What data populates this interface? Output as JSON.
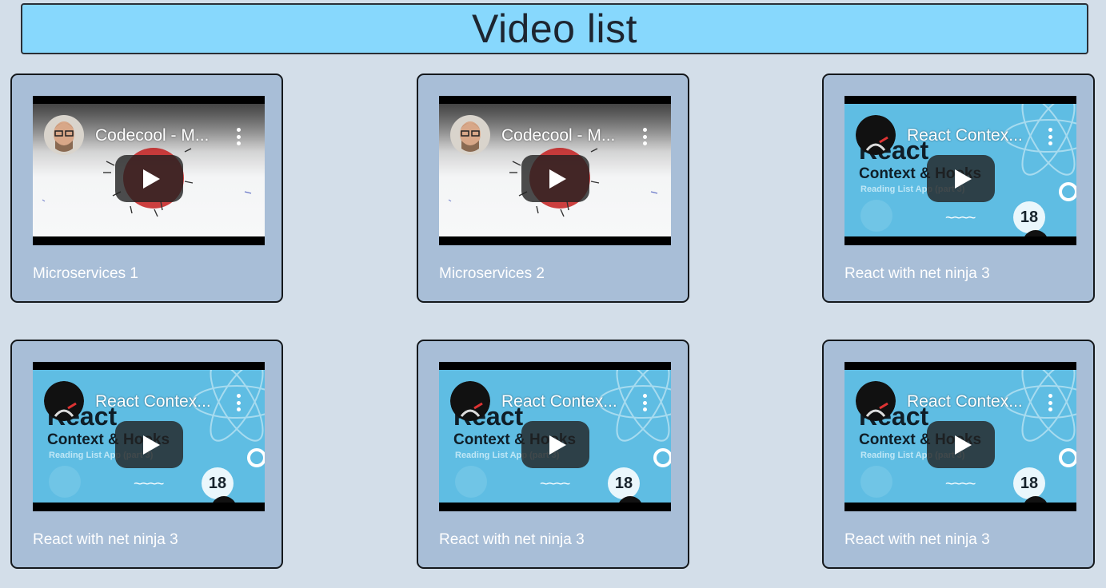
{
  "page": {
    "title": "Video list"
  },
  "colors": {
    "background": "#d3dee9",
    "header_bg": "#87d8fd",
    "card_bg": "#a8bed7",
    "card_border": "#14181c",
    "label_text": "#ffffff"
  },
  "videos": [
    {
      "label": "Microservices 1",
      "embed_title": "Codecool - M...",
      "thumbnail": "codecool",
      "icons": [
        "avatar-icon",
        "kebab-menu-icon",
        "play-icon"
      ]
    },
    {
      "label": "Microservices 2",
      "embed_title": "Codecool - M...",
      "thumbnail": "codecool",
      "icons": [
        "avatar-icon",
        "kebab-menu-icon",
        "play-icon"
      ]
    },
    {
      "label": "React with net ninja 3",
      "embed_title": "React Contex...",
      "thumbnail": "react",
      "thumb_text": {
        "big": "React",
        "sub": "Context & Hooks",
        "small": "Reading List App (part 3)",
        "badge": "18"
      },
      "icons": [
        "ninja-avatar-icon",
        "kebab-menu-icon",
        "play-icon"
      ]
    },
    {
      "label": "React with net ninja 3",
      "embed_title": "React Contex...",
      "thumbnail": "react",
      "thumb_text": {
        "big": "React",
        "sub": "Context & Hooks",
        "small": "Reading List App (part 3)",
        "badge": "18"
      },
      "icons": [
        "ninja-avatar-icon",
        "kebab-menu-icon",
        "play-icon"
      ]
    },
    {
      "label": "React with net ninja 3",
      "embed_title": "React Contex...",
      "thumbnail": "react",
      "thumb_text": {
        "big": "React",
        "sub": "Context & Hooks",
        "small": "Reading List App (part 3)",
        "badge": "18"
      },
      "icons": [
        "ninja-avatar-icon",
        "kebab-menu-icon",
        "play-icon"
      ]
    },
    {
      "label": "React with net ninja 3",
      "embed_title": "React Contex...",
      "thumbnail": "react",
      "thumb_text": {
        "big": "React",
        "sub": "Context & Hooks",
        "small": "Reading List App (part 3)",
        "badge": "18"
      },
      "icons": [
        "ninja-avatar-icon",
        "kebab-menu-icon",
        "play-icon"
      ]
    }
  ]
}
